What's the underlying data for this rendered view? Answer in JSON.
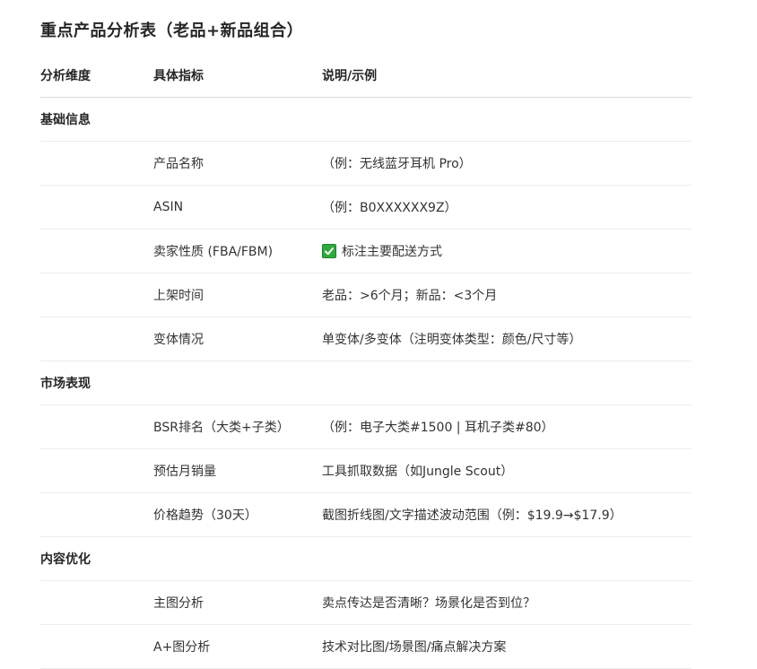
{
  "title": "重点产品分析表（老品+新品组合）",
  "headers": [
    "分析维度",
    "具体指标",
    "说明/示例"
  ],
  "sections": [
    {
      "name": "基础信息",
      "rows": [
        {
          "metric": "产品名称",
          "desc": "（例：无线蓝牙耳机 Pro）"
        },
        {
          "metric": "ASIN",
          "desc": "（例：B0XXXXXX9Z）"
        },
        {
          "metric": "卖家性质 (FBA/FBM)",
          "desc": "标注主要配送方式",
          "icon": "check-mark-icon"
        },
        {
          "metric": "上架时间",
          "desc": "老品：>6个月；新品：<3个月"
        },
        {
          "metric": "变体情况",
          "desc": "单变体/多变体（注明变体类型：颜色/尺寸等）"
        }
      ]
    },
    {
      "name": "市场表现",
      "rows": [
        {
          "metric": "BSR排名（大类+子类）",
          "desc": "（例：电子大类#1500 | 耳机子类#80）"
        },
        {
          "metric": "预估月销量",
          "desc": "工具抓取数据（如Jungle Scout）"
        },
        {
          "metric": "价格趋势（30天）",
          "desc": "截图折线图/文字描述波动范围（例：$19.9→$17.9）"
        }
      ]
    },
    {
      "name": "内容优化",
      "rows": [
        {
          "metric": "主图分析",
          "desc": "卖点传达是否清晰？场景化是否到位？"
        },
        {
          "metric": "A+图分析",
          "desc": "技术对比图/场景图/痛点解决方案"
        }
      ]
    }
  ]
}
